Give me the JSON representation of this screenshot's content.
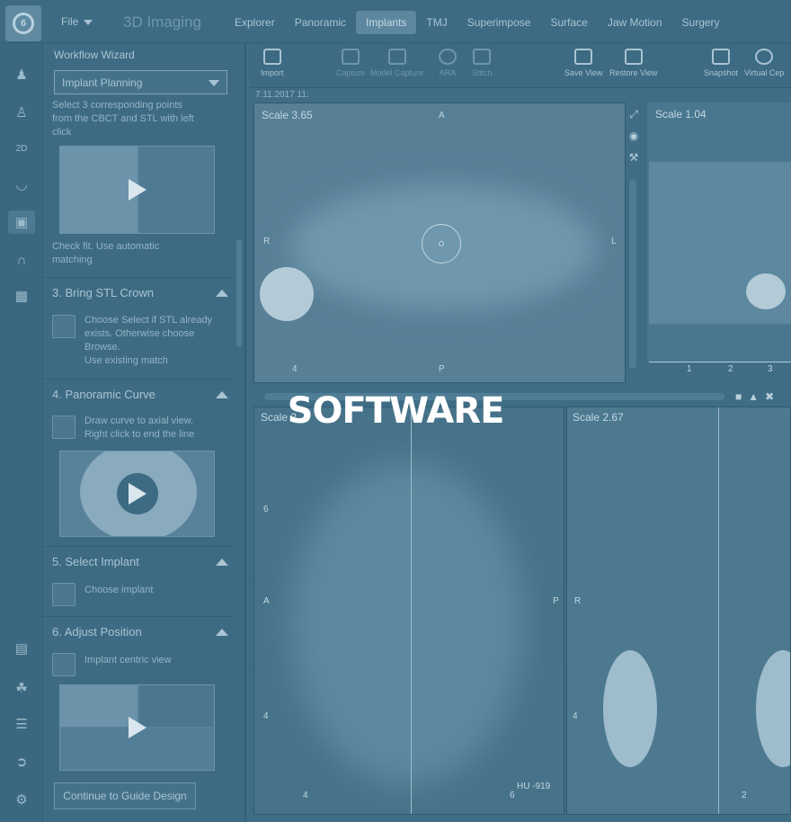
{
  "app": {
    "title": "3D Imaging",
    "logo_glyph": "6",
    "file_menu": "File"
  },
  "tabs": [
    {
      "label": "Explorer",
      "active": false
    },
    {
      "label": "Panoramic",
      "active": false
    },
    {
      "label": "Implants",
      "active": true
    },
    {
      "label": "TMJ",
      "active": false
    },
    {
      "label": "Superimpose",
      "active": false
    },
    {
      "label": "Surface",
      "active": false
    },
    {
      "label": "Jaw Motion",
      "active": false
    },
    {
      "label": "Surgery",
      "active": false
    }
  ],
  "rail": {
    "icons": [
      "patients-icon",
      "person-icon",
      "2d-icon",
      "arch-icon",
      "cube-icon",
      "curve-icon",
      "teeth-icon",
      "report-icon",
      "chair-icon",
      "user-list-icon",
      "login-icon",
      "user-settings-icon"
    ]
  },
  "wizard": {
    "title": "Workflow Wizard",
    "select_value": "Implant Planning",
    "step2_text_lines": [
      "Select 3 corresponding points",
      "from the CBCT and STL with left",
      "click"
    ],
    "step2_fit_lines": [
      "Check fit. Use automatic",
      "matching"
    ],
    "sections": [
      {
        "label": "3. Bring STL Crown",
        "lines": [
          "Choose Select if STL already",
          "exists. Otherwise choose",
          "Browse.",
          "Use existing match"
        ]
      },
      {
        "label": "4. Panoramic Curve",
        "lines": [
          "Draw curve to axial view.",
          "Right click to end the line"
        ]
      },
      {
        "label": "5. Select Implant",
        "lines": [
          "Choose implant"
        ]
      },
      {
        "label": "6. Adjust Position",
        "lines": [
          "Implant centric view"
        ]
      }
    ],
    "button": "Continue to Guide Design"
  },
  "toolbar": [
    {
      "label": "Import",
      "icon": "import-icon",
      "enabled": true
    },
    {
      "label": "Capture",
      "icon": "capture-icon",
      "enabled": false
    },
    {
      "label": "Model Capture",
      "icon": "model-capture-icon",
      "enabled": false
    },
    {
      "label": "ARA",
      "icon": "ara-icon",
      "enabled": false
    },
    {
      "label": "Stitch",
      "icon": "stitch-icon",
      "enabled": false
    },
    {
      "label": "Save View",
      "icon": "save-view-icon",
      "enabled": true
    },
    {
      "label": "Restore View",
      "icon": "restore-view-icon",
      "enabled": true
    },
    {
      "label": "Snapshot",
      "icon": "snapshot-icon",
      "enabled": true
    },
    {
      "label": "Virtual Cep",
      "icon": "virtual-ceph-icon",
      "enabled": true
    }
  ],
  "viewports": {
    "timestamp": "7.11.2017 11:",
    "axial": {
      "scale": "Scale 3.65",
      "top": "A",
      "left": "R",
      "right": "L",
      "bottom": "P",
      "tick": "4"
    },
    "sagittal": {
      "scale": "Scale 1.04",
      "ruler": [
        "1",
        "2",
        "3"
      ]
    },
    "cross_left": {
      "scale": "Scale 2.",
      "left": "A",
      "right": "P",
      "hu": "HU -919",
      "ticks": [
        "6",
        "4",
        "4",
        "6"
      ]
    },
    "cross_right": {
      "scale": "Scale 2.67",
      "left": "R",
      "ticks": [
        "4",
        "2"
      ]
    }
  },
  "overlay": {
    "title": "SOFTWARE"
  },
  "colors": {
    "tint": "#3f6d85",
    "overlay_text": "#ffffff"
  }
}
